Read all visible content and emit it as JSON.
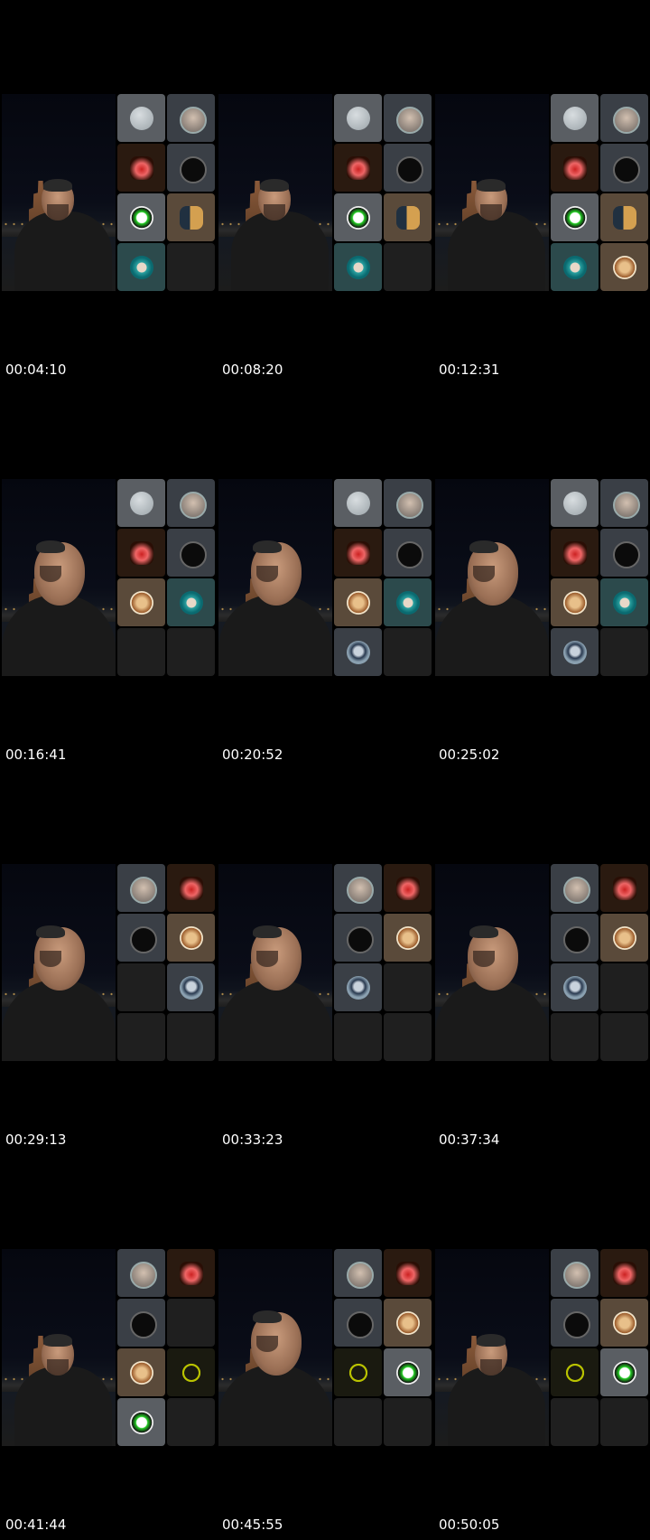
{
  "frames": [
    {
      "timestamp": "00:04:10",
      "tiles": [
        "moon-avatar",
        "face-avatar",
        "fire-emoji-avatar",
        "black-circle-avatar",
        "cartoon-avatar",
        "couple-avatar",
        "teal-avatar",
        "empty"
      ]
    },
    {
      "timestamp": "00:08:20",
      "tiles": [
        "moon-avatar",
        "face-avatar",
        "fire-emoji-avatar",
        "black-circle-avatar",
        "cartoon-avatar",
        "couple-avatar",
        "teal-avatar",
        "empty"
      ]
    },
    {
      "timestamp": "00:12:31",
      "tiles": [
        "moon-avatar",
        "face-avatar",
        "fire-emoji-avatar",
        "black-circle-avatar",
        "cartoon-avatar",
        "couple-avatar",
        "teal-avatar",
        "lion-avatar"
      ]
    },
    {
      "timestamp": "00:16:41",
      "tiles": [
        "moon-avatar",
        "face-avatar",
        "fire-emoji-avatar",
        "black-circle-avatar",
        "lion-avatar",
        "teal-avatar",
        "empty",
        "empty"
      ]
    },
    {
      "timestamp": "00:20:52",
      "tiles": [
        "moon-avatar",
        "face-avatar",
        "fire-emoji-avatar",
        "black-circle-avatar",
        "lion-avatar",
        "teal-avatar",
        "cap-avatar",
        "empty"
      ]
    },
    {
      "timestamp": "00:25:02",
      "tiles": [
        "moon-avatar",
        "face-avatar",
        "fire-emoji-avatar",
        "black-circle-avatar",
        "lion-avatar",
        "teal-avatar",
        "cap-avatar",
        "empty"
      ]
    },
    {
      "timestamp": "00:29:13",
      "tiles": [
        "face-avatar",
        "fire-emoji-avatar",
        "black-circle-avatar",
        "lion-avatar",
        "empty",
        "cap-avatar",
        "empty",
        "empty"
      ]
    },
    {
      "timestamp": "00:33:23",
      "tiles": [
        "face-avatar",
        "fire-emoji-avatar",
        "black-circle-avatar",
        "lion-avatar",
        "cap-avatar",
        "empty",
        "empty",
        "empty"
      ]
    },
    {
      "timestamp": "00:37:34",
      "tiles": [
        "face-avatar",
        "fire-emoji-avatar",
        "black-circle-avatar",
        "lion-avatar",
        "cap-avatar",
        "empty",
        "empty",
        "empty"
      ]
    },
    {
      "timestamp": "00:41:44",
      "tiles": [
        "face-avatar",
        "fire-emoji-avatar",
        "black-circle-avatar",
        "empty",
        "lion-avatar",
        "sun-avatar",
        "cartoon-avatar",
        "empty"
      ]
    },
    {
      "timestamp": "00:45:55",
      "tiles": [
        "face-avatar",
        "fire-emoji-avatar",
        "black-circle-avatar",
        "lion-avatar",
        "sun-avatar",
        "cartoon-avatar",
        "empty",
        "empty"
      ]
    },
    {
      "timestamp": "00:50:05",
      "tiles": [
        "face-avatar",
        "fire-emoji-avatar",
        "black-circle-avatar",
        "lion-avatar",
        "sun-avatar",
        "cartoon-avatar",
        "empty",
        "empty"
      ]
    }
  ]
}
